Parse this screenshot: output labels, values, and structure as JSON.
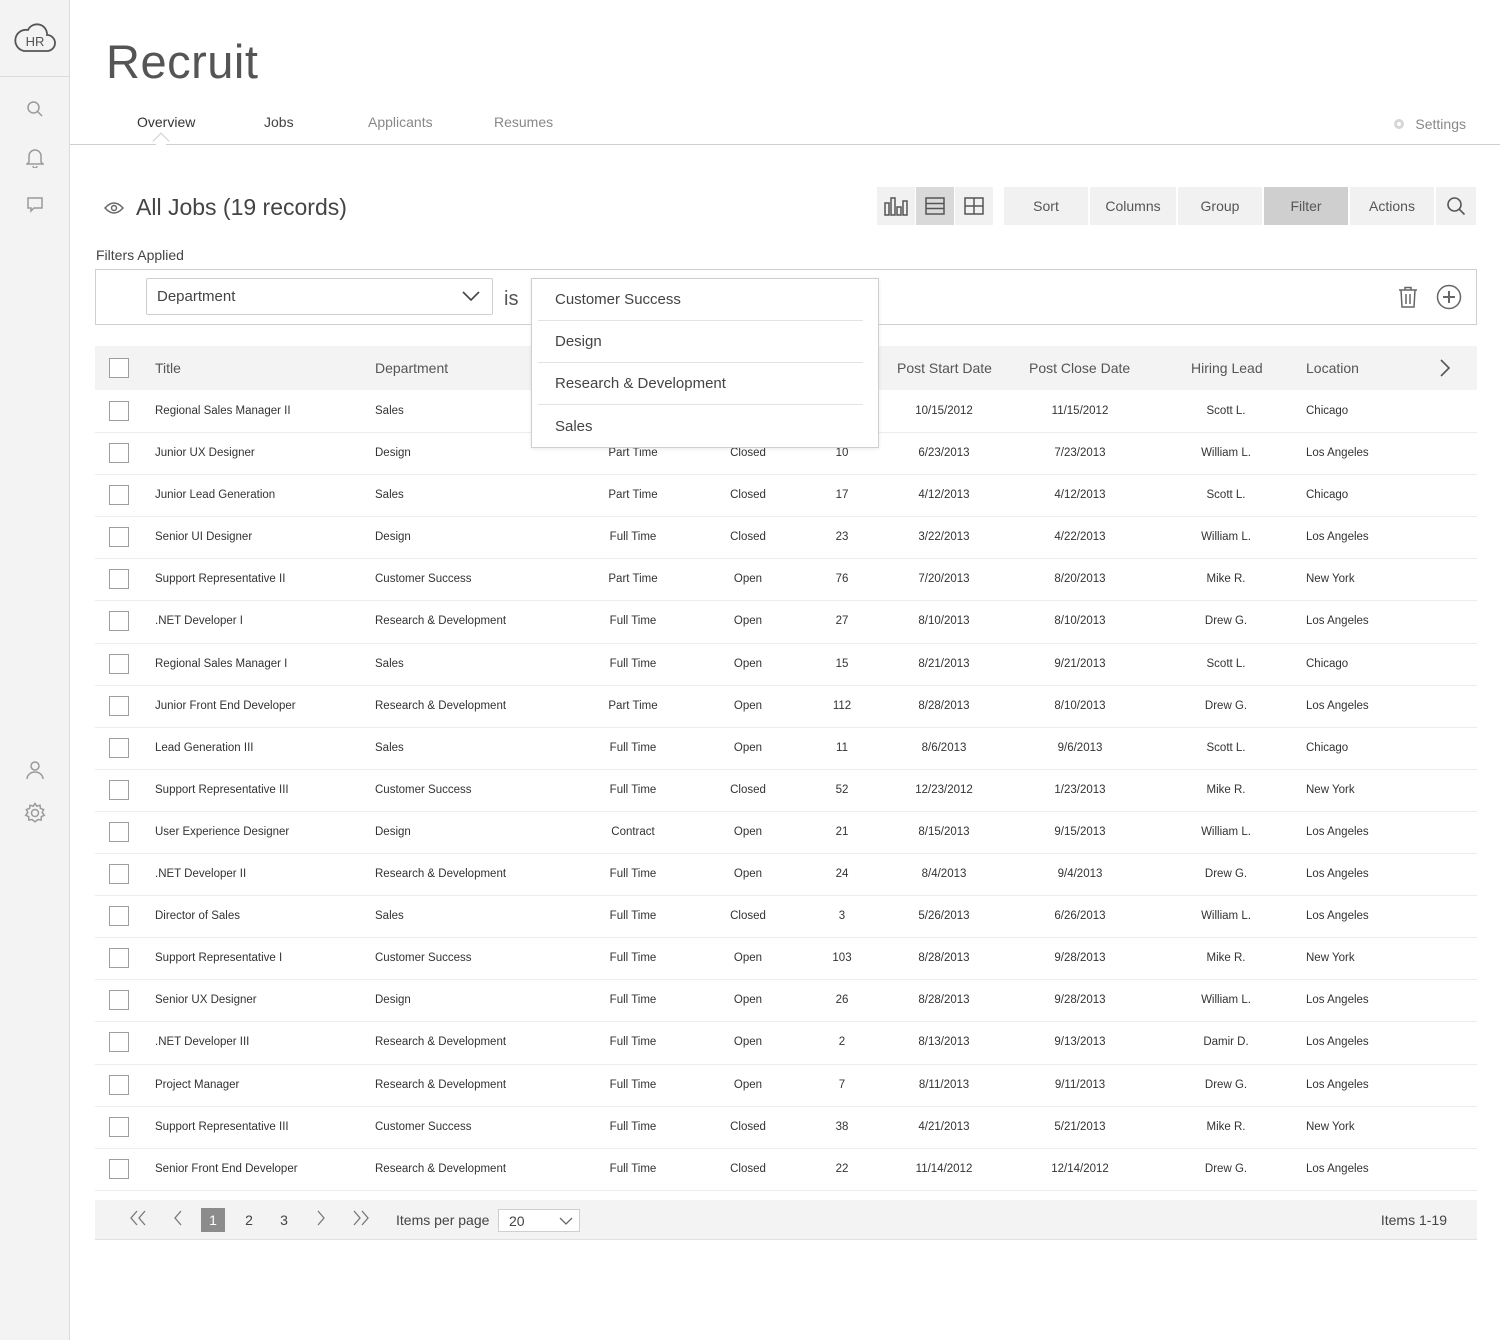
{
  "logo": {
    "text": "HR"
  },
  "app": {
    "title": "Recruit"
  },
  "tabs": [
    {
      "label": "Overview"
    },
    {
      "label": "Jobs"
    },
    {
      "label": "Applicants"
    },
    {
      "label": "Resumes"
    }
  ],
  "settings": {
    "label": "Settings"
  },
  "view": {
    "title": "All Jobs (19 records)"
  },
  "toolbar": {
    "sort": "Sort",
    "columns": "Columns",
    "group": "Group",
    "filter": "Filter",
    "actions": "Actions"
  },
  "filters": {
    "label": "Filters Applied",
    "field": "Department",
    "operator": "is"
  },
  "dropdown": {
    "options": [
      "Customer Success",
      "Design",
      "Research & Development",
      "Sales"
    ]
  },
  "table": {
    "headers": {
      "title": "Title",
      "department": "Department",
      "post_start": "Post Start Date",
      "post_close": "Post Close Date",
      "hiring_lead": "Hiring Lead",
      "location": "Location"
    },
    "rows": [
      [
        "Regional Sales Manager II",
        "Sales",
        "",
        "",
        "",
        "10/15/2012",
        "11/15/2012",
        "Scott L.",
        "Chicago"
      ],
      [
        "Junior UX Designer",
        "Design",
        "Part Time",
        "Closed",
        "10",
        "6/23/2013",
        "7/23/2013",
        "William L.",
        "Los Angeles"
      ],
      [
        "Junior Lead Generation",
        "Sales",
        "Part Time",
        "Closed",
        "17",
        "4/12/2013",
        "4/12/2013",
        "Scott L.",
        "Chicago"
      ],
      [
        "Senior UI Designer",
        "Design",
        "Full Time",
        "Closed",
        "23",
        "3/22/2013",
        "4/22/2013",
        "William L.",
        "Los Angeles"
      ],
      [
        "Support Representative II",
        "Customer Success",
        "Part Time",
        "Open",
        "76",
        "7/20/2013",
        "8/20/2013",
        "Mike R.",
        "New York"
      ],
      [
        ".NET Developer I",
        "Research & Development",
        "Full Time",
        "Open",
        "27",
        "8/10/2013",
        "8/10/2013",
        "Drew G.",
        "Los Angeles"
      ],
      [
        "Regional Sales Manager I",
        "Sales",
        "Full Time",
        "Open",
        "15",
        "8/21/2013",
        "9/21/2013",
        "Scott L.",
        "Chicago"
      ],
      [
        "Junior Front End Developer",
        "Research & Development",
        "Part Time",
        "Open",
        "112",
        "8/28/2013",
        "8/10/2013",
        "Drew G.",
        "Los Angeles"
      ],
      [
        "Lead Generation III",
        "Sales",
        "Full Time",
        "Open",
        "11",
        "8/6/2013",
        "9/6/2013",
        "Scott L.",
        "Chicago"
      ],
      [
        "Support Representative III",
        "Customer Success",
        "Full Time",
        "Closed",
        "52",
        "12/23/2012",
        "1/23/2013",
        "Mike R.",
        "New York"
      ],
      [
        "User Experience Designer",
        "Design",
        "Contract",
        "Open",
        "21",
        "8/15/2013",
        "9/15/2013",
        "William L.",
        "Los Angeles"
      ],
      [
        ".NET Developer II",
        "Research & Development",
        "Full Time",
        "Open",
        "24",
        "8/4/2013",
        "9/4/2013",
        "Drew G.",
        "Los Angeles"
      ],
      [
        "Director of Sales",
        "Sales",
        "Full Time",
        "Closed",
        "3",
        "5/26/2013",
        "6/26/2013",
        "William L.",
        "Los Angeles"
      ],
      [
        "Support Representative I",
        "Customer Success",
        "Full Time",
        "Open",
        "103",
        "8/28/2013",
        "9/28/2013",
        "Mike R.",
        "New York"
      ],
      [
        "Senior UX Designer",
        "Design",
        "Full Time",
        "Open",
        "26",
        "8/28/2013",
        "9/28/2013",
        "William L.",
        "Los Angeles"
      ],
      [
        ".NET Developer III",
        "Research & Development",
        "Full Time",
        "Open",
        "2",
        "8/13/2013",
        "9/13/2013",
        "Damir D.",
        "Los Angeles"
      ],
      [
        "Project Manager",
        "Research & Development",
        "Full Time",
        "Open",
        "7",
        "8/11/2013",
        "9/11/2013",
        "Drew G.",
        "Los Angeles"
      ],
      [
        "Support Representative III",
        "Customer Success",
        "Full Time",
        "Closed",
        "38",
        "4/21/2013",
        "5/21/2013",
        "Mike R.",
        "New York"
      ],
      [
        "Senior Front End Developer",
        "Research & Development",
        "Full Time",
        "Closed",
        "22",
        "11/14/2012",
        "12/14/2012",
        "Drew G.",
        "Los Angeles"
      ]
    ]
  },
  "pagination": {
    "pages": [
      "1",
      "2",
      "3"
    ],
    "items_per_page_label": "Items per page",
    "items_per_page_value": "20",
    "items_count": "Items 1-19"
  }
}
